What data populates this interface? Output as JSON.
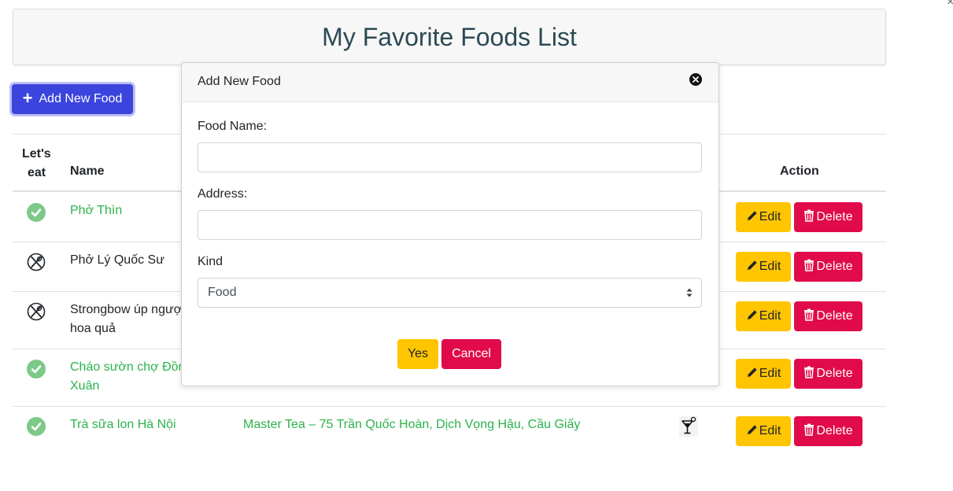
{
  "page": {
    "title": "My Favorite Foods List",
    "add_button_label": "Add New Food"
  },
  "table": {
    "headers": {
      "lets_eat_line1": "Let's",
      "lets_eat_line2": "eat",
      "name": "Name",
      "action": "Action"
    },
    "rows": [
      {
        "eaten": true,
        "name_line1": "Phở Thìn",
        "name_line2": "",
        "address": "",
        "kind_icon": ""
      },
      {
        "eaten": false,
        "name_line1": "Phở Lý Quốc Sư",
        "name_line2": "",
        "address": "",
        "kind_icon": ""
      },
      {
        "eaten": false,
        "name_line1": "Strongbow úp ngượ",
        "name_line2": "hoa quả",
        "address": "",
        "kind_icon": ""
      },
      {
        "eaten": true,
        "name_line1": "Cháo sườn chợ Đồn",
        "name_line2": "Xuân",
        "address": "",
        "kind_icon": ""
      },
      {
        "eaten": true,
        "name_line1": "Trà sữa lon Hà Nội",
        "name_line2": "",
        "address": "Master Tea – 75 Trần Quốc Hoàn, Dịch Vọng Hậu, Cầu Giấy",
        "kind_icon": "cocktail-icon"
      }
    ],
    "edit_label": "Edit",
    "delete_label": "Delete"
  },
  "modal": {
    "title": "Add New Food",
    "food_name_label": "Food Name:",
    "food_name_value": "",
    "address_label": "Address:",
    "address_value": "",
    "kind_label": "Kind",
    "kind_selected": "Food",
    "yes_label": "Yes",
    "cancel_label": "Cancel"
  },
  "colors": {
    "primary": "#3b44dd",
    "eaten_text": "#2bb34a",
    "check_bg": "#7cc98a",
    "edit": "#ffc500",
    "delete": "#e10a4a",
    "title_text": "#2c4a54"
  }
}
